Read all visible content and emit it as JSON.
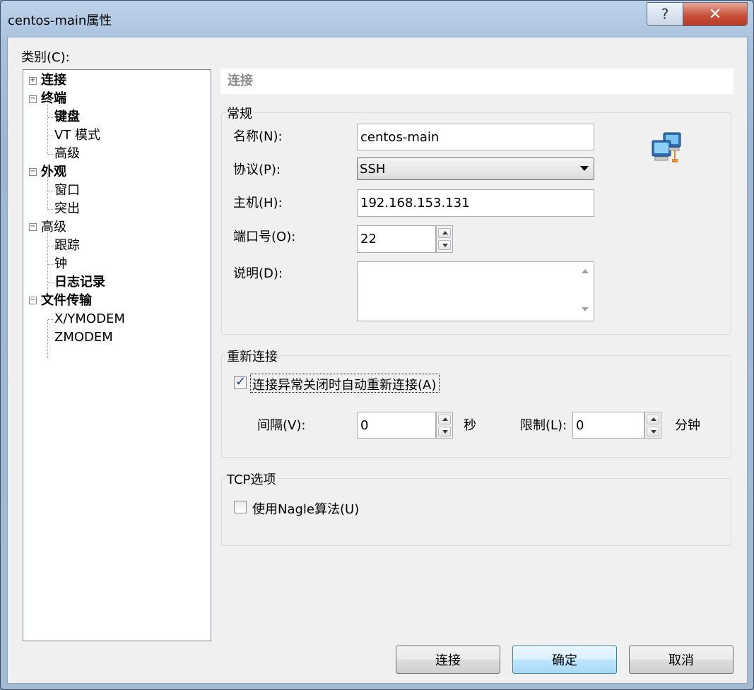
{
  "window": {
    "title": "centos-main属性",
    "help_glyph": "?",
    "close_glyph": "✕"
  },
  "category_label": "类别(C):",
  "tree": [
    {
      "label": "连接",
      "bold": true
    },
    {
      "label": "终端",
      "bold": true
    },
    {
      "label": "键盘",
      "bold": true
    },
    {
      "label": "VT 模式",
      "bold": false
    },
    {
      "label": "高级",
      "bold": false
    },
    {
      "label": "外观",
      "bold": true
    },
    {
      "label": "窗口",
      "bold": false
    },
    {
      "label": "突出",
      "bold": false
    },
    {
      "label": "高级",
      "bold": false
    },
    {
      "label": "跟踪",
      "bold": false
    },
    {
      "label": "钟",
      "bold": false
    },
    {
      "label": "日志记录",
      "bold": true
    },
    {
      "label": "文件传输",
      "bold": true
    },
    {
      "label": "X/YMODEM",
      "bold": false
    },
    {
      "label": "ZMODEM",
      "bold": false
    }
  ],
  "section_header": "连接",
  "general": {
    "title": "常规",
    "name_label": "名称(N):",
    "name_value": "centos-main",
    "protocol_label": "协议(P):",
    "protocol_value": "SSH",
    "host_label": "主机(H):",
    "host_value": "192.168.153.131",
    "port_label": "端口号(O):",
    "port_value": "22",
    "desc_label": "说明(D):",
    "desc_value": "",
    "network_icon": "network-computers-icon"
  },
  "reconnect": {
    "title": "重新连接",
    "auto_label": "连接异常关闭时自动重新连接(A)",
    "auto_checked": true,
    "interval_label": "间隔(V):",
    "interval_value": "0",
    "interval_unit": "秒",
    "limit_label": "限制(L):",
    "limit_value": "0",
    "limit_unit": "分钟"
  },
  "tcp": {
    "title": "TCP选项",
    "nagle_label": "使用Nagle算法(U)",
    "nagle_checked": false
  },
  "buttons": {
    "connect": "连接",
    "ok": "确定",
    "cancel": "取消"
  },
  "colors": {
    "accent": "#3c7fb1",
    "close": "#c9523b"
  }
}
